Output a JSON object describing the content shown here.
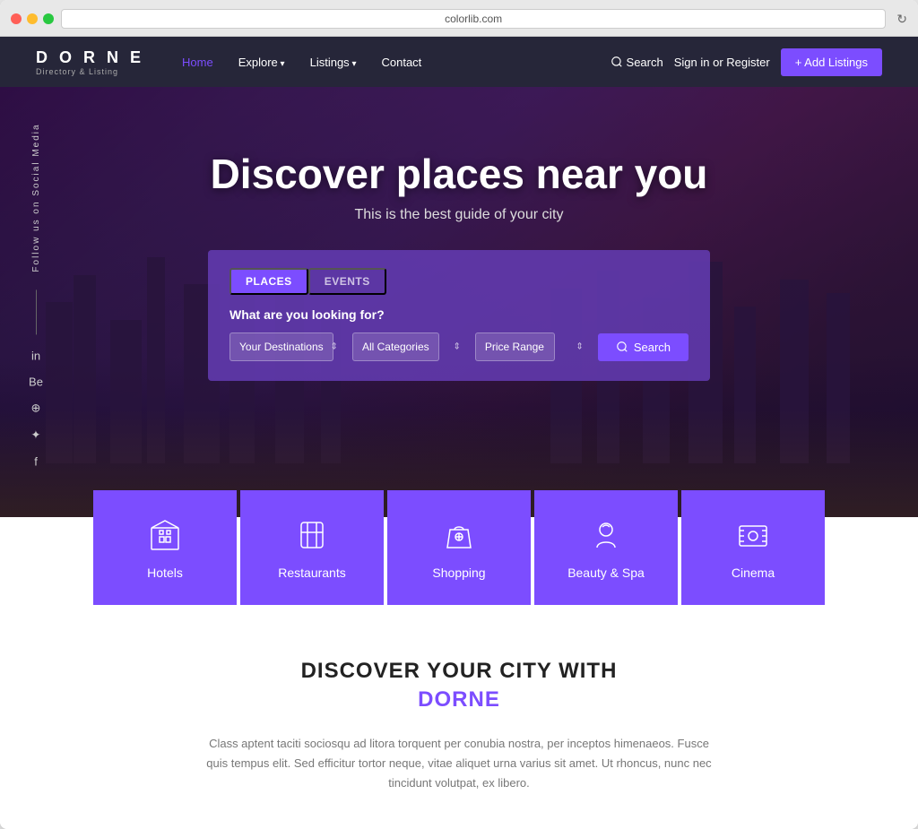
{
  "browser": {
    "url": "colorlib.com",
    "refresh_label": "↻"
  },
  "navbar": {
    "logo_title": "D O R N E",
    "logo_sub": "Directory & Listing",
    "nav_home": "Home",
    "nav_explore": "Explore",
    "nav_listings": "Listings",
    "nav_contact": "Contact",
    "nav_search": "Search",
    "nav_signin": "Sign in or Register",
    "btn_add": "+ Add Listings"
  },
  "hero": {
    "title": "Discover places near you",
    "subtitle": "This is the best guide of your city",
    "social_label": "Follow us on Social Media",
    "social_icons": [
      "in",
      "Be",
      "✿",
      "✦",
      "f"
    ],
    "tab_places": "PLACES",
    "tab_events": "EVENTS",
    "search_label": "What are you looking for?",
    "placeholder_destination": "Your Destinations",
    "placeholder_categories": "All Categories",
    "placeholder_price": "Price Range",
    "btn_search": "Search"
  },
  "categories": [
    {
      "id": "hotels",
      "label": "Hotels",
      "icon": "🏨"
    },
    {
      "id": "restaurants",
      "label": "Restaurants",
      "icon": "🍽️"
    },
    {
      "id": "shopping",
      "label": "Shopping",
      "icon": "🛍️"
    },
    {
      "id": "beauty-spa",
      "label": "Beauty & Spa",
      "icon": "💆"
    },
    {
      "id": "cinema",
      "label": "Cinema",
      "icon": "🎬"
    }
  ],
  "discover": {
    "title": "DISCOVER YOUR CITY WITH",
    "brand": "DORNE",
    "description": "Class aptent taciti sociosqu ad litora torquent per conubia nostra, per inceptos himenaeos. Fusce quis tempus elit. Sed efficitur tortor neque, vitae aliquet urna varius sit amet. Ut rhoncus, nunc nec tincidunt volutpat, ex libero."
  }
}
